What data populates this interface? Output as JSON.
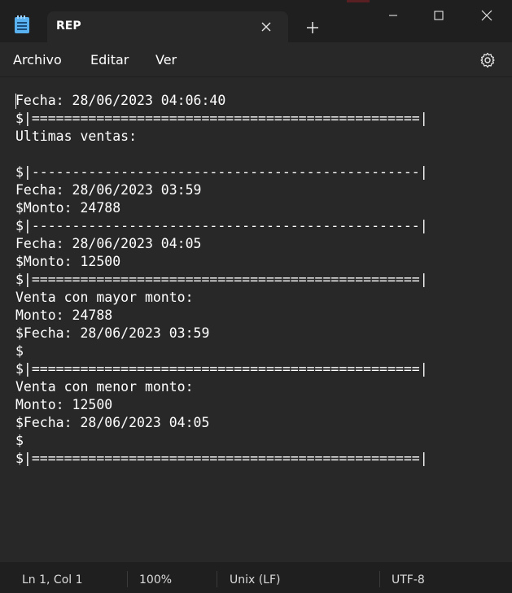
{
  "window": {
    "tab_title": "REP",
    "tab_close_icon": "close-icon",
    "new_tab_icon": "plus-icon",
    "controls": [
      "minimize-icon",
      "maximize-icon",
      "close-icon"
    ]
  },
  "menu": {
    "items": [
      "Archivo",
      "Editar",
      "Ver"
    ],
    "settings_icon": "gear-icon"
  },
  "editor": {
    "lines": [
      "Fecha: 28/06/2023 04:06:40",
      "$|================================================|",
      "Ultimas ventas:",
      "",
      "$|------------------------------------------------|",
      "Fecha: 28/06/2023 03:59",
      "$Monto: 24788",
      "$|------------------------------------------------|",
      "Fecha: 28/06/2023 04:05",
      "$Monto: 12500",
      "$|================================================|",
      "Venta con mayor monto:",
      "Monto: 24788",
      "$Fecha: 28/06/2023 03:59",
      "$",
      "$|================================================|",
      "Venta con menor monto:",
      "Monto: 12500",
      "$Fecha: 28/06/2023 04:05",
      "$",
      "$|================================================|"
    ]
  },
  "status": {
    "position": "Ln 1, Col 1",
    "zoom": "100%",
    "line_ending": "Unix (LF)",
    "encoding": "UTF-8"
  },
  "colors": {
    "editor_bg": "#282828",
    "chrome_bg": "#1f1f1f",
    "text": "#ffffff"
  }
}
